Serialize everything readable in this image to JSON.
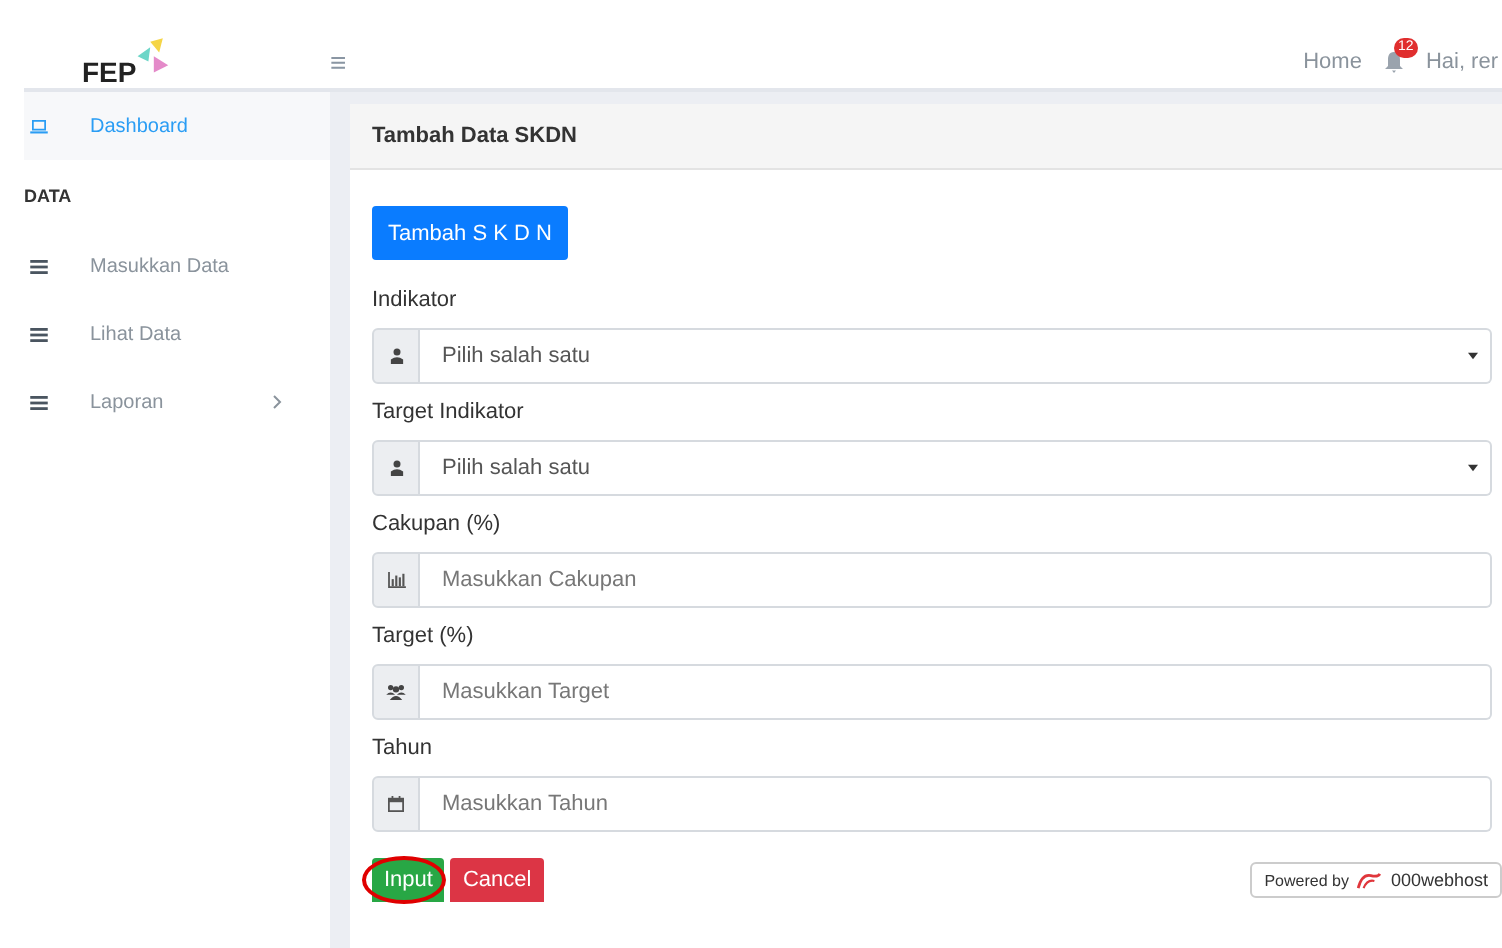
{
  "header": {
    "logo": "FEP",
    "menu_icon": "≡",
    "links": [
      "Home"
    ],
    "notification_count": "12",
    "greeting": "Hai, rer"
  },
  "sidebar": {
    "items": [
      {
        "label": "Dashboard",
        "selected": true,
        "kind": "link"
      },
      {
        "label": "DATA",
        "kind": "heading"
      },
      {
        "label": "Masukkan Data",
        "selected": false,
        "kind": "link"
      },
      {
        "label": "Lihat Data",
        "selected": false,
        "kind": "link"
      },
      {
        "label": "Laporan",
        "selected": false,
        "kind": "submenu"
      }
    ]
  },
  "card": {
    "title": "Tambah Data SKDN",
    "top_button": "Tambah S K D N",
    "fields": [
      {
        "label": "Indikator",
        "kind": "select",
        "placeholder": "Pilih salah satu"
      },
      {
        "label": "Target Indikator",
        "kind": "select",
        "placeholder": "Pilih salah satu"
      },
      {
        "label": "Cakupan (%)",
        "kind": "input",
        "placeholder": "Masukkan Cakupan"
      },
      {
        "label": "Target (%)",
        "kind": "input",
        "placeholder": "Masukkan Target"
      },
      {
        "label": "Tahun",
        "kind": "input",
        "placeholder": "Masukkan Tahun"
      }
    ],
    "buttons": [
      {
        "label": "Input",
        "kind": "submit",
        "highlighted": true
      },
      {
        "label": "Cancel",
        "kind": "cancel",
        "highlighted": false
      }
    ]
  },
  "footer_badge": {
    "prefix": "Powered by",
    "brand": "000webhost"
  }
}
